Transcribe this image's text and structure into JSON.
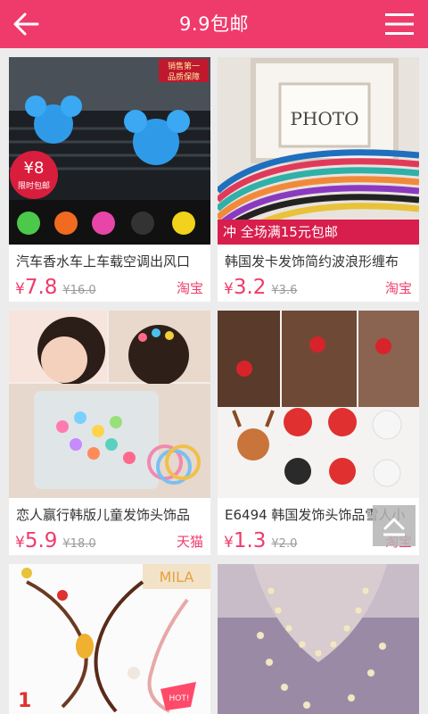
{
  "header": {
    "title": "9.9包邮",
    "back_icon": "back-arrow-icon",
    "menu_icon": "hamburger-menu-icon",
    "background": "#ef3b6c"
  },
  "currency": "¥",
  "products": [
    {
      "name": "汽车香水车上车载空调出风口",
      "price": "7.8",
      "original_price": "¥16.0",
      "shop": "淘宝",
      "image_badge": "¥8",
      "image_badge_sub": "限时包邮",
      "image_tag_line1": "销售第一",
      "image_tag_line2": "品质保障"
    },
    {
      "name": "韩国发卡发饰简约波浪形缠布",
      "price": "3.2",
      "original_price": "¥3.6",
      "shop": "淘宝",
      "image_sign": "PHOTO",
      "image_banner": "冲 全场满15元包邮"
    },
    {
      "name": "恋人赢行韩版儿童发饰头饰品",
      "price": "5.9",
      "original_price": "¥18.0",
      "shop": "天猫"
    },
    {
      "name": "E6494 韩国发饰头饰品雪人小",
      "price": "1.3",
      "original_price": "¥2.0",
      "shop": "淘宝"
    },
    {
      "image_text": "MILA",
      "image_hot": "HOT!"
    },
    {}
  ],
  "scroll_top_icon": "scroll-to-top-icon"
}
